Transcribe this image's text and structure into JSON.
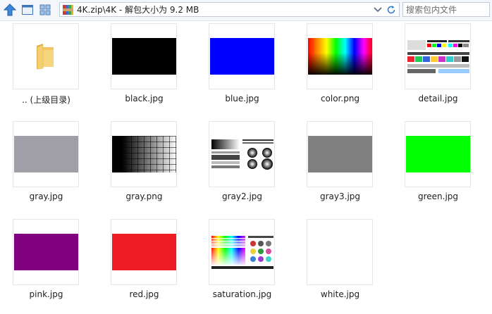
{
  "toolbar": {
    "address": "4K.zip\\4K - 解包大小为 9.2 MB",
    "search_placeholder": "搜索包内文件"
  },
  "colors": {
    "black": "#000000",
    "blue": "#0000ff",
    "gray": "#a09fa8",
    "gray3": "#808080",
    "green": "#00ff00",
    "pink": "#800080",
    "red": "#ee1c23",
    "white": "#ffffff"
  },
  "items": [
    {
      "label": ".. (上级目录)",
      "kind": "folder-icon"
    },
    {
      "label": "black.jpg"
    },
    {
      "label": "blue.jpg"
    },
    {
      "label": "color.png"
    },
    {
      "label": "detail.jpg"
    },
    {
      "label": "gray.jpg"
    },
    {
      "label": "gray.png"
    },
    {
      "label": "gray2.jpg"
    },
    {
      "label": "gray3.jpg"
    },
    {
      "label": "green.jpg"
    },
    {
      "label": "pink.jpg"
    },
    {
      "label": "red.jpg"
    },
    {
      "label": "saturation.jpg"
    },
    {
      "label": "white.jpg"
    }
  ]
}
